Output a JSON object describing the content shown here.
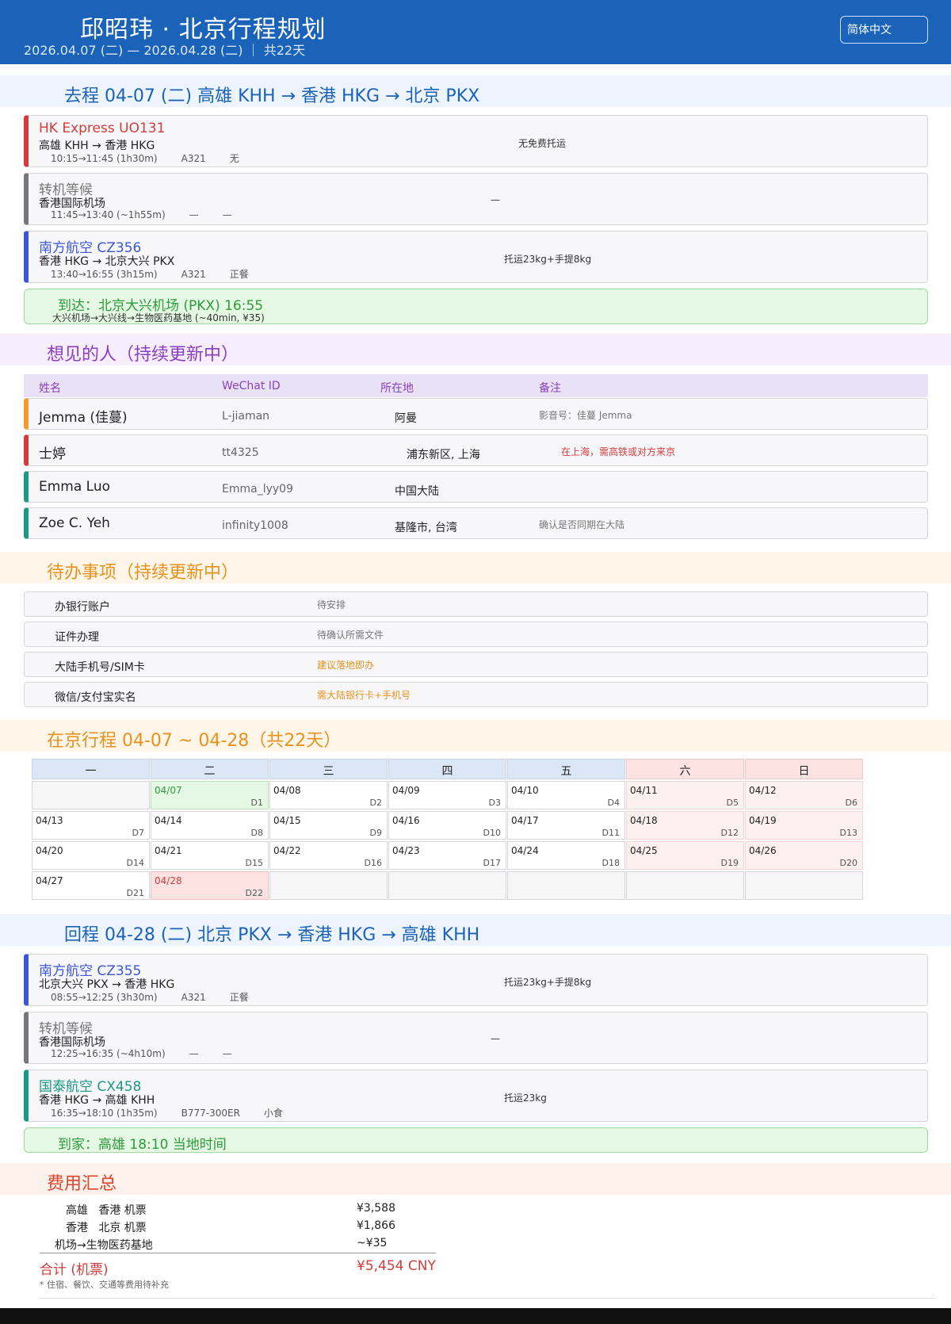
{
  "header": {
    "title": "邱昭玮 · 北京行程规划",
    "subtitle": "2026.04.07 (二) — 2026.04.28 (二) ｜ 共22天",
    "language": "简体中文"
  },
  "outbound": {
    "title": "去程  04-07 (二) 高雄 KHH → 香港 HKG → 北京 PKX",
    "segments": [
      {
        "carrier": "HK Express UO131",
        "route": "高雄 KHH → 香港 HKG",
        "time": "10:15→11:45 (1h30m)",
        "aircraft": "A321",
        "meal": "无",
        "note": "无免费托运"
      },
      {
        "carrier": "转机等候",
        "route": "香港国际机场",
        "time": "11:45→13:40 (~1h55m)",
        "aircraft": "—",
        "meal": "—",
        "note": "—"
      },
      {
        "carrier": "南方航空 CZ356",
        "route": "香港 HKG → 北京大兴 PKX",
        "time": "13:40→16:55 (3h15m)",
        "aircraft": "A321",
        "meal": "正餐",
        "note": "托运23kg+手提8kg"
      }
    ],
    "arrival": {
      "title": "到达：北京大兴机场 (PKX) 16:55",
      "sub": "大兴机场→大兴线→生物医药基地 (~40min, ¥35)"
    }
  },
  "people": {
    "title": "想见的人（持续更新中）",
    "headers": [
      "姓名",
      "WeChat ID",
      "所在地",
      "备注"
    ],
    "rows": [
      {
        "name": "Jemma (佳蔓)",
        "wechat": "L-jiaman",
        "location": "阿曼",
        "note": "影音号：佳蔓 Jemma"
      },
      {
        "name": "士婷",
        "wechat": "tt4325",
        "location": "浦东新区, 上海",
        "note": "在上海，需高铁或对方来京"
      },
      {
        "name": "Emma Luo",
        "wechat": "Emma_lyy09",
        "location": "中国大陆",
        "note": ""
      },
      {
        "name": "Zoe C. Yeh",
        "wechat": "infinity1008",
        "location": "基隆市, 台湾",
        "note": "确认是否同期在大陆"
      }
    ]
  },
  "todo": {
    "title": "待办事项（持续更新中）",
    "items": [
      {
        "item": "办银行账户",
        "status": "待安排"
      },
      {
        "item": "证件办理",
        "status": "待确认所需文件"
      },
      {
        "item": "大陆手机号/SIM卡",
        "status": "建议落地即办"
      },
      {
        "item": "微信/支付宝实名",
        "status": "需大陆银行卡+手机号"
      }
    ]
  },
  "calendar": {
    "title": "在京行程  04-07 ~ 04-28（共22天）",
    "weekdays": [
      "一",
      "二",
      "三",
      "四",
      "五",
      "六",
      "日"
    ],
    "rows": [
      [
        null,
        {
          "date": "04/07",
          "day": "D1"
        },
        {
          "date": "04/08",
          "day": "D2"
        },
        {
          "date": "04/09",
          "day": "D3"
        },
        {
          "date": "04/10",
          "day": "D4"
        },
        {
          "date": "04/11",
          "day": "D5"
        },
        {
          "date": "04/12",
          "day": "D6"
        }
      ],
      [
        {
          "date": "04/13",
          "day": "D7"
        },
        {
          "date": "04/14",
          "day": "D8"
        },
        {
          "date": "04/15",
          "day": "D9"
        },
        {
          "date": "04/16",
          "day": "D10"
        },
        {
          "date": "04/17",
          "day": "D11"
        },
        {
          "date": "04/18",
          "day": "D12"
        },
        {
          "date": "04/19",
          "day": "D13"
        }
      ],
      [
        {
          "date": "04/20",
          "day": "D14"
        },
        {
          "date": "04/21",
          "day": "D15"
        },
        {
          "date": "04/22",
          "day": "D16"
        },
        {
          "date": "04/23",
          "day": "D17"
        },
        {
          "date": "04/24",
          "day": "D18"
        },
        {
          "date": "04/25",
          "day": "D19"
        },
        {
          "date": "04/26",
          "day": "D20"
        }
      ],
      [
        {
          "date": "04/27",
          "day": "D21"
        },
        {
          "date": "04/28",
          "day": "D22"
        },
        null,
        null,
        null,
        null,
        null
      ]
    ]
  },
  "return": {
    "title": "回程  04-28 (二) 北京 PKX → 香港 HKG → 高雄 KHH",
    "segments": [
      {
        "carrier": "南方航空 CZ355",
        "route": "北京大兴 PKX → 香港 HKG",
        "time": "08:55→12:25 (3h30m)",
        "aircraft": "A321",
        "meal": "正餐",
        "note": "托运23kg+手提8kg"
      },
      {
        "carrier": "转机等候",
        "route": "香港国际机场",
        "time": "12:25→16:35 (~4h10m)",
        "aircraft": "—",
        "meal": "—",
        "note": "—"
      },
      {
        "carrier": "国泰航空 CX458",
        "route": "香港 HKG → 高雄 KHH",
        "time": "16:35→18:10 (1h35m)",
        "aircraft": "B777-300ER",
        "meal": "小食",
        "note": "托运23kg"
      }
    ],
    "arrival": {
      "title": "到家：高雄 18:10 当地时间"
    }
  },
  "costs": {
    "title": "费用汇总",
    "items": [
      {
        "label": "高雄   香港 机票",
        "amount": "¥3,588"
      },
      {
        "label": "香港   北京 机票",
        "amount": "¥1,866"
      },
      {
        "label": "机场→生物医药基地",
        "amount": "~¥35"
      }
    ],
    "total_label": "合计 (机票)",
    "total_amount": "¥5,454 CNY",
    "footnote": "* 住宿、餐饮、交通等费用待补充"
  }
}
